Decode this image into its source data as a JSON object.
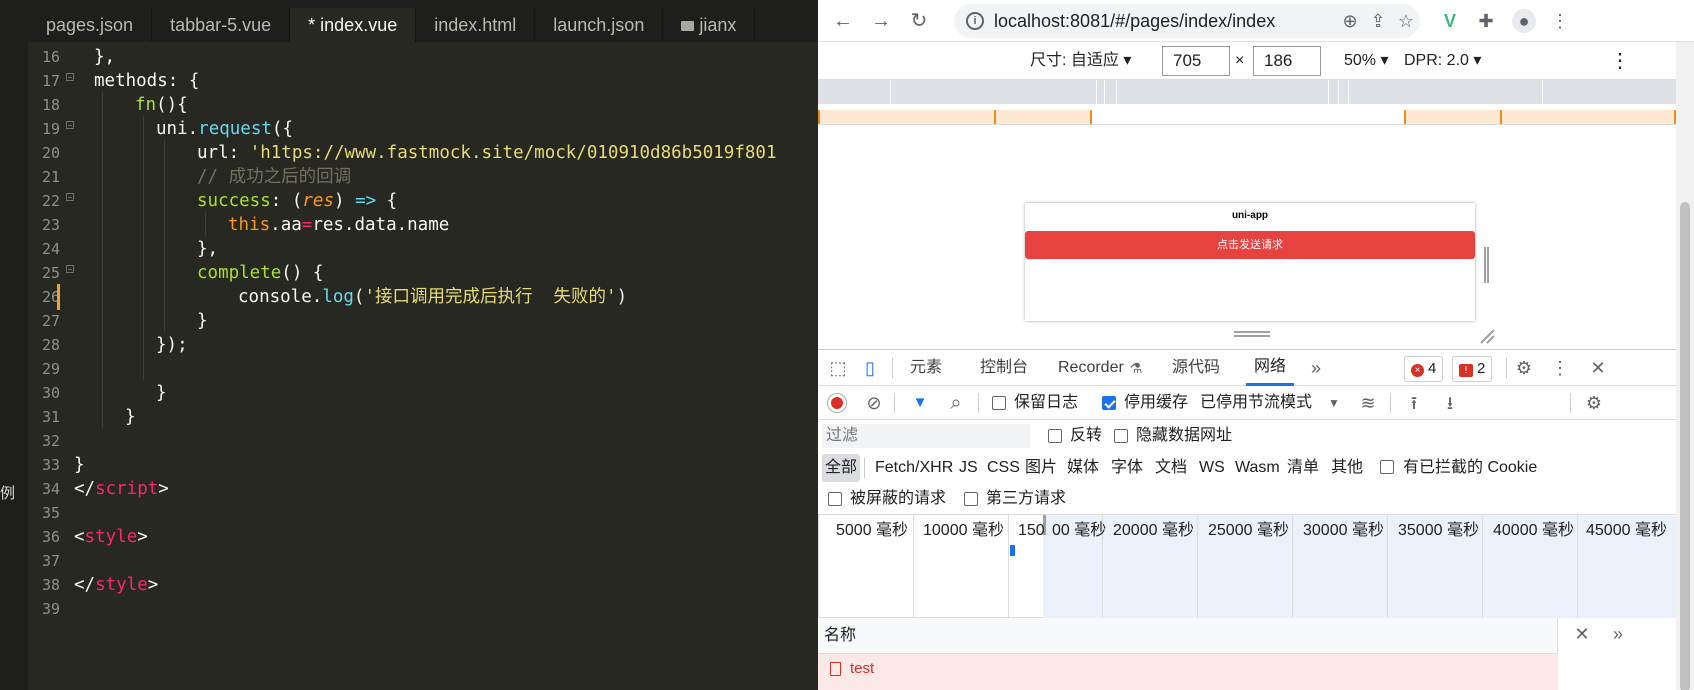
{
  "editor": {
    "side_char": "例",
    "tabs": [
      {
        "label": "pages.json",
        "active": false
      },
      {
        "label": "tabbar-5.vue",
        "active": false
      },
      {
        "label": "* index.vue",
        "active": true
      },
      {
        "label": "index.html",
        "active": false
      },
      {
        "label": "launch.json",
        "active": false
      },
      {
        "label": "jianx",
        "active": false,
        "folder": true
      }
    ],
    "line_numbers": [
      "16",
      "17",
      "18",
      "19",
      "20",
      "21",
      "22",
      "23",
      "24",
      "25",
      "26",
      "27",
      "28",
      "29",
      "30",
      "31",
      "32",
      "33",
      "34",
      "35",
      "36",
      "37",
      "38",
      "39"
    ],
    "code": {
      "l16": "},",
      "l17": "methods: {",
      "l18_fn": "fn",
      "l18_rest": "(){",
      "l19_obj": "uni.",
      "l19_fn": "request",
      "l19_rest": "({",
      "l20_key": "url: ",
      "l20_str": "'h1tps://www.fastmock.site/mock/010910d86b5019f801",
      "l21_comment": "// 成功之后的回调",
      "l22_key": "success",
      "l22_colon": ": (",
      "l22_param": "res",
      "l22_paren": ") ",
      "l22_arrow": "=>",
      "l22_brace": " {",
      "l23_this": "this",
      "l23_aa": ".aa",
      "l23_eq": "=",
      "l23_rest": "res.data.name",
      "l24": "},",
      "l25_fn": "complete",
      "l25_rest": "() {",
      "l26_obj": "console.",
      "l26_fn": "log",
      "l26_open": "(",
      "l26_str": "'接口调用完成后执行  失败的'",
      "l26_close": ")",
      "l27": "}",
      "l28": "});",
      "l30": "}",
      "l31": "}",
      "l33": "}",
      "l34_open": "</",
      "l34_tag": "script",
      "l34_close": ">",
      "l36_open": "<",
      "l36_tag": "style",
      "l36_close": ">",
      "l38_open": "</",
      "l38_tag": "style",
      "l38_close": ">"
    }
  },
  "browser": {
    "back_icon": "←",
    "forward_icon": "→",
    "reload_icon": "↻",
    "info_icon": "i",
    "url": "localhost:8081/#/pages/index/index",
    "zoom_icon": "⊕",
    "share_icon": "⇪",
    "star_icon": "☆",
    "vue_icon": "V",
    "puzzle_icon": "✚",
    "profile_icon": "●",
    "menu_icon": "⋮",
    "device": {
      "size_label": "尺寸: 自适应 ▾",
      "width": "705",
      "times": "×",
      "height": "186",
      "zoom": "50% ▾",
      "dpr": "DPR: 2.0 ▾",
      "more": "⋮"
    },
    "page": {
      "title": "uni-app",
      "button": "点击发送请求"
    },
    "devtools": {
      "inspect_icon": "⬚",
      "device_icon": "▯",
      "tabs": [
        "元素",
        "控制台",
        "Recorder",
        "源代码",
        "网络"
      ],
      "recorder_icon": "⚗",
      "more_tabs": "»",
      "errors": "4",
      "warnings": "2",
      "error_glyph": "×",
      "warning_glyph": "!",
      "settings_icon": "⚙",
      "kebab_icon": "⋮",
      "close_icon": "✕",
      "toolbar": {
        "clear_icon": "⊘",
        "filter_icon": "▼",
        "search_icon": "⌕",
        "preserve_log": "保留日志",
        "disable_cache": "停用缓存",
        "throttle": "已停用节流模式",
        "throttle_arrow": "▼",
        "wifi_icon": "≋",
        "upload_icon": "⭱",
        "download_icon": "⭳",
        "settings_icon": "⚙"
      },
      "filter": {
        "placeholder": "过滤",
        "invert": "反转",
        "hide_data_urls": "隐藏数据网址"
      },
      "types": [
        "全部",
        "Fetch/XHR",
        "JS",
        "CSS",
        "图片",
        "媒体",
        "字体",
        "文档",
        "WS",
        "Wasm",
        "清单",
        "其他"
      ],
      "blocked_cookies": "有已拦截的 Cookie",
      "blocked_requests": "被屏蔽的请求",
      "third_party": "第三方请求",
      "timeline": [
        "5000 毫秒",
        "10000 毫秒",
        "150",
        "00 毫秒",
        "20000 毫秒",
        "25000 毫秒",
        "30000 毫秒",
        "35000 毫秒",
        "40000 毫秒",
        "45000 毫秒"
      ],
      "name_header": "名称",
      "row_name": "test",
      "side_close": "✕",
      "side_more": "»"
    }
  }
}
